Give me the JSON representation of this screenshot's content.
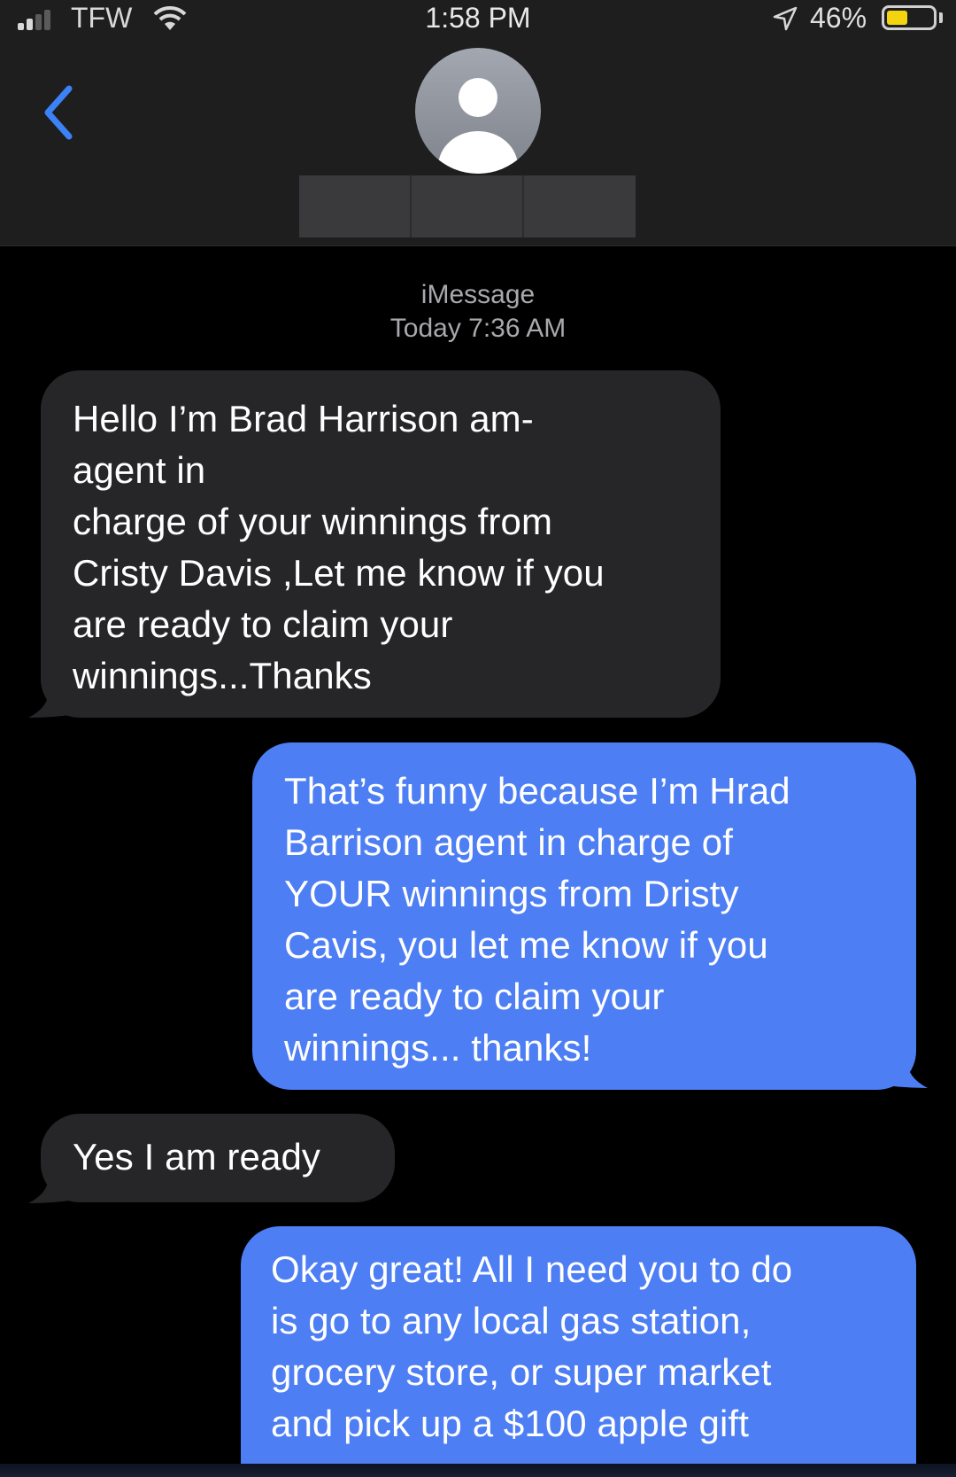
{
  "status_bar": {
    "carrier": "TFW",
    "time": "1:58 PM",
    "battery_percent": "46%",
    "battery_level": 0.46,
    "icons": [
      "signal-bars-icon",
      "wifi-icon",
      "location-arrow-icon",
      "battery-icon"
    ]
  },
  "header": {
    "back_icon": "chevron-left-icon",
    "avatar_icon": "person-silhouette-icon"
  },
  "thread": {
    "service": "iMessage",
    "timestamp": "Today 7:36 AM"
  },
  "messages": [
    {
      "direction": "incoming",
      "text": "Hello I’m Brad Harrison am-\nagent in\ncharge of your winnings from\nCristy Davis ,Let me know if you\nare ready to claim your\nwinnings...Thanks"
    },
    {
      "direction": "outgoing",
      "text": "That’s funny because I’m Hrad\nBarrison agent in charge of\nYOUR winnings from Dristy\nCavis, you let me know if you\nare ready to claim your\nwinnings... thanks!"
    },
    {
      "direction": "incoming",
      "text": "Yes I am ready"
    },
    {
      "direction": "outgoing",
      "text": "Okay great! All I need you to do\nis go to any local gas station,\ngrocery store, or super market\nand pick up a $100 apple gift"
    }
  ],
  "colors": {
    "incoming_bubble": "#262628",
    "outgoing_bubble": "#4d7ef4",
    "header_bg": "#1e1e1f",
    "accent_blue": "#3c82f6"
  }
}
